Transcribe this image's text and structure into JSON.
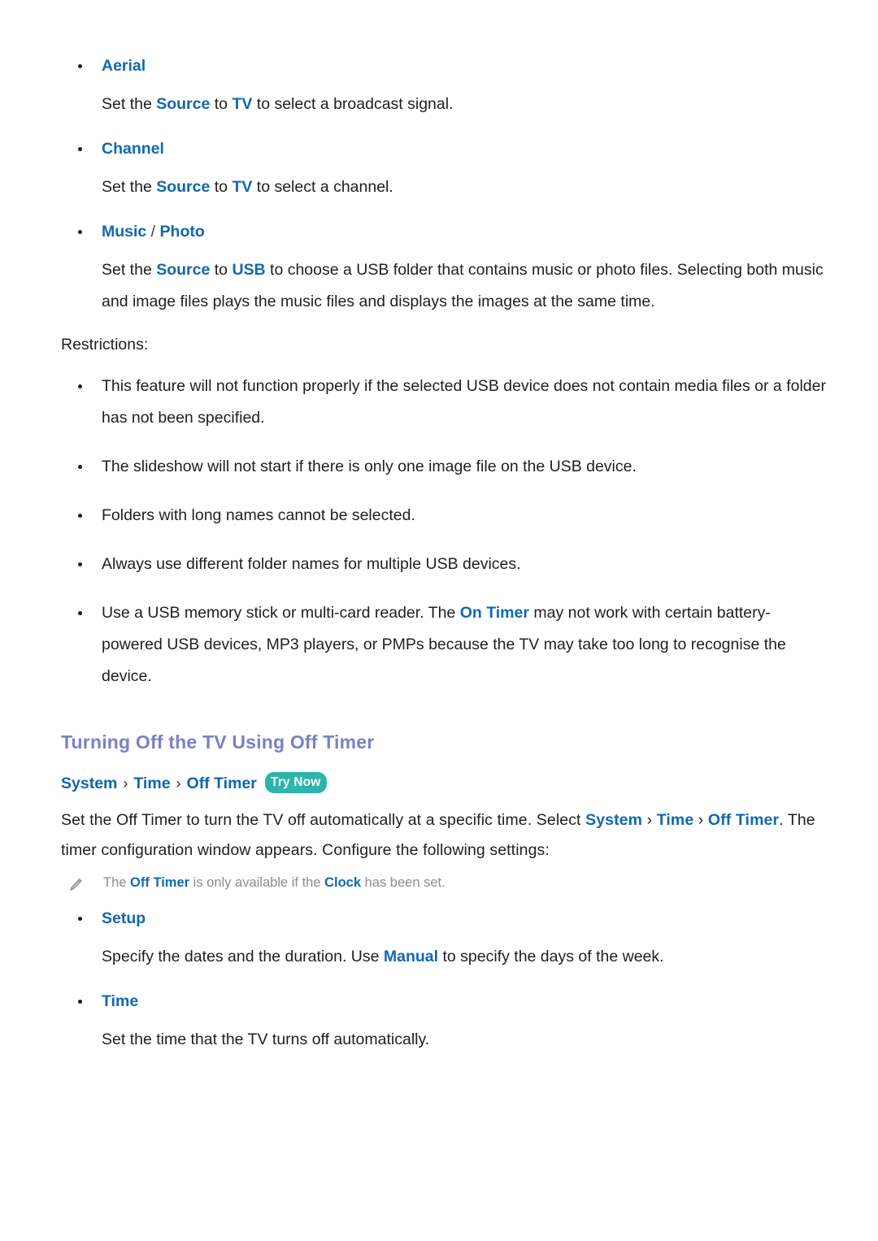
{
  "page": {
    "colors": {
      "term_blue": "#1168b3",
      "breadcrumb_blue": "#1064b0",
      "heading_purple": "#7b80c6",
      "badge_teal": "#2bb5ab",
      "body_text": "#1f1f1f",
      "note_gray": "#8c8c8c",
      "background": "#ffffff"
    }
  },
  "source_list": {
    "items": [
      {
        "title_parts": [
          {
            "text": "Aerial",
            "style": "term"
          }
        ],
        "title_plain": "Aerial",
        "desc_parts": [
          {
            "text": "Set the ",
            "style": "plain"
          },
          {
            "text": "Source",
            "style": "term"
          },
          {
            "text": " to ",
            "style": "plain"
          },
          {
            "text": "TV",
            "style": "term"
          },
          {
            "text": " to select a broadcast signal.",
            "style": "plain"
          }
        ],
        "desc_plain": "Set the Source to TV to select a broadcast signal."
      },
      {
        "title_parts": [
          {
            "text": "Channel",
            "style": "term"
          }
        ],
        "title_plain": "Channel",
        "desc_parts": [
          {
            "text": "Set the ",
            "style": "plain"
          },
          {
            "text": "Source",
            "style": "term"
          },
          {
            "text": " to ",
            "style": "plain"
          },
          {
            "text": "TV",
            "style": "term"
          },
          {
            "text": " to select a channel.",
            "style": "plain"
          }
        ],
        "desc_plain": "Set the Source to TV to select a channel."
      },
      {
        "title_parts": [
          {
            "text": "Music",
            "style": "term"
          },
          {
            "text": " / ",
            "style": "sep"
          },
          {
            "text": "Photo",
            "style": "term"
          }
        ],
        "title_plain": "Music / Photo",
        "desc_parts": [
          {
            "text": "Set the ",
            "style": "plain"
          },
          {
            "text": "Source",
            "style": "term"
          },
          {
            "text": " to ",
            "style": "plain"
          },
          {
            "text": "USB",
            "style": "term"
          },
          {
            "text": " to choose a USB folder that contains music or photo files. Selecting both music and image files plays the music files and displays the images at the same time.",
            "style": "plain"
          }
        ],
        "desc_plain": "Set the Source to USB to choose a USB folder that contains music or photo files. Selecting both music and image files plays the music files and displays the images at the same time."
      }
    ]
  },
  "restrictions": {
    "label": "Restrictions:",
    "items": [
      {
        "parts": [
          {
            "text": "This feature will not function properly if the selected USB device does not contain media files or a folder has not been specified.",
            "style": "plain"
          }
        ],
        "plain": "This feature will not function properly if the selected USB device does not contain media files or a folder has not been specified."
      },
      {
        "parts": [
          {
            "text": "The slideshow will not start if there is only one image file on the USB device.",
            "style": "plain"
          }
        ],
        "plain": "The slideshow will not start if there is only one image file on the USB device."
      },
      {
        "parts": [
          {
            "text": "Folders with long names cannot be selected.",
            "style": "plain"
          }
        ],
        "plain": "Folders with long names cannot be selected."
      },
      {
        "parts": [
          {
            "text": "Always use different folder names for multiple USB devices.",
            "style": "plain"
          }
        ],
        "plain": "Always use different folder names for multiple USB devices."
      },
      {
        "parts": [
          {
            "text": "Use a USB memory stick or multi-card reader. The ",
            "style": "plain"
          },
          {
            "text": "On Timer",
            "style": "term"
          },
          {
            "text": " may not work with certain battery-powered USB devices, MP3 players, or PMPs because the TV may take too long to recognise the device.",
            "style": "plain"
          }
        ],
        "plain": "Use a USB memory stick or multi-card reader. The On Timer may not work with certain battery-powered USB devices, MP3 players, or PMPs because the TV may take too long to recognise the device."
      }
    ]
  },
  "off_timer_section": {
    "heading": "Turning Off the TV Using Off Timer",
    "breadcrumb": {
      "items": [
        "System",
        "Time",
        "Off Timer"
      ],
      "separator": "›",
      "badge": "Try Now"
    },
    "intro_parts": [
      {
        "text": "Set the Off Timer to turn the TV off automatically at a specific time. Select ",
        "style": "plain"
      },
      {
        "text": "System",
        "style": "term"
      },
      {
        "text": " › ",
        "style": "chev"
      },
      {
        "text": "Time",
        "style": "term"
      },
      {
        "text": " › ",
        "style": "chev"
      },
      {
        "text": "Off Timer",
        "style": "term"
      },
      {
        "text": ". The timer configuration window appears. Configure the following settings:",
        "style": "plain"
      }
    ],
    "intro_plain": "Set the Off Timer to turn the TV off automatically at a specific time. Select System › Time › Off Timer. The timer configuration window appears. Configure the following settings:",
    "note": {
      "icon": "pencil-icon",
      "parts": [
        {
          "text": "The ",
          "style": "plain"
        },
        {
          "text": "Off Timer",
          "style": "term"
        },
        {
          "text": " is only available if the ",
          "style": "plain"
        },
        {
          "text": "Clock",
          "style": "term"
        },
        {
          "text": " has been set.",
          "style": "plain"
        }
      ],
      "plain": "The Off Timer is only available if the Clock has been set."
    },
    "settings": [
      {
        "title_parts": [
          {
            "text": "Setup",
            "style": "term"
          }
        ],
        "title_plain": "Setup",
        "desc_parts": [
          {
            "text": "Specify the dates and the duration. Use ",
            "style": "plain"
          },
          {
            "text": "Manual",
            "style": "term"
          },
          {
            "text": " to specify the days of the week.",
            "style": "plain"
          }
        ],
        "desc_plain": "Specify the dates and the duration. Use Manual to specify the days of the week."
      },
      {
        "title_parts": [
          {
            "text": "Time",
            "style": "term"
          }
        ],
        "title_plain": "Time",
        "desc_parts": [
          {
            "text": "Set the time that the TV turns off automatically.",
            "style": "plain"
          }
        ],
        "desc_plain": "Set the time that the TV turns off automatically."
      }
    ]
  }
}
